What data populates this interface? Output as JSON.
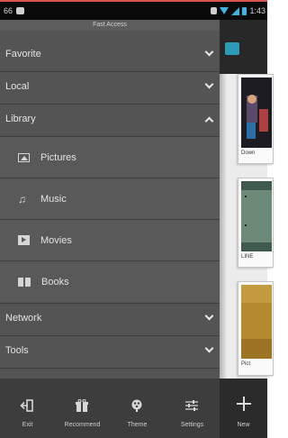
{
  "statusbar": {
    "left_text": "66",
    "time": "1:43",
    "colors": {
      "wifi": "#3fb3e2",
      "accent_strip": "#d9534f"
    }
  },
  "drawer": {
    "title": "Fast Access",
    "categories": [
      {
        "label": "Favorite",
        "expanded": false
      },
      {
        "label": "Local",
        "expanded": false
      },
      {
        "label": "Library",
        "expanded": true
      },
      {
        "label": "Network",
        "expanded": false
      },
      {
        "label": "Tools",
        "expanded": false
      }
    ],
    "library_items": [
      {
        "label": "Pictures",
        "icon": "picture-icon"
      },
      {
        "label": "Music",
        "icon": "music-icon"
      },
      {
        "label": "Movies",
        "icon": "movie-icon"
      },
      {
        "label": "Books",
        "icon": "book-icon"
      }
    ]
  },
  "bottom_bar": {
    "items": [
      {
        "label": "Exit",
        "icon": "exit-icon"
      },
      {
        "label": "Recommend",
        "icon": "gift-icon"
      },
      {
        "label": "Theme",
        "icon": "palette-icon"
      },
      {
        "label": "Settings",
        "icon": "sliders-icon"
      }
    ]
  },
  "right_pane": {
    "thumb_labels": [
      "Down",
      "LINE",
      "Pict"
    ],
    "new_label": "New"
  }
}
